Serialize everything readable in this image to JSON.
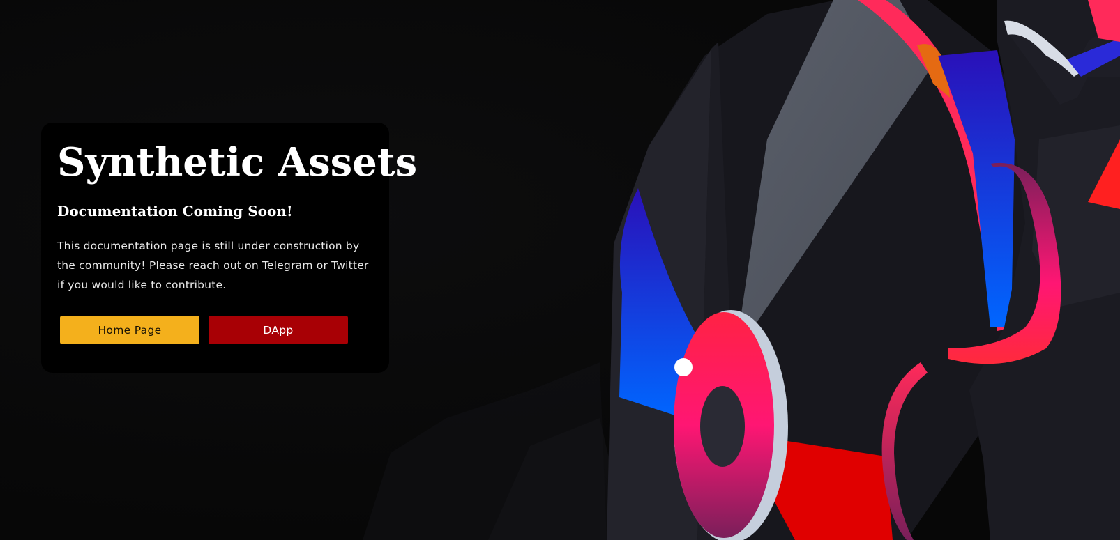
{
  "hero": {
    "title": "Synthetic Assets",
    "subtitle": "Documentation Coming Soon!",
    "body": "This documentation page is still under construction by the community! Please reach out on Telegram or Twitter if you would like to contribute."
  },
  "buttons": {
    "home_label": "Home Page",
    "dapp_label": "DApp"
  },
  "colors": {
    "background": "#0b0b0c",
    "card": "#000000",
    "home_button": "#f4b01c",
    "dapp_button": "#a80005",
    "accent_pink": "#ff1f5a",
    "accent_blue": "#1a3cff",
    "accent_red": "#e00000"
  }
}
